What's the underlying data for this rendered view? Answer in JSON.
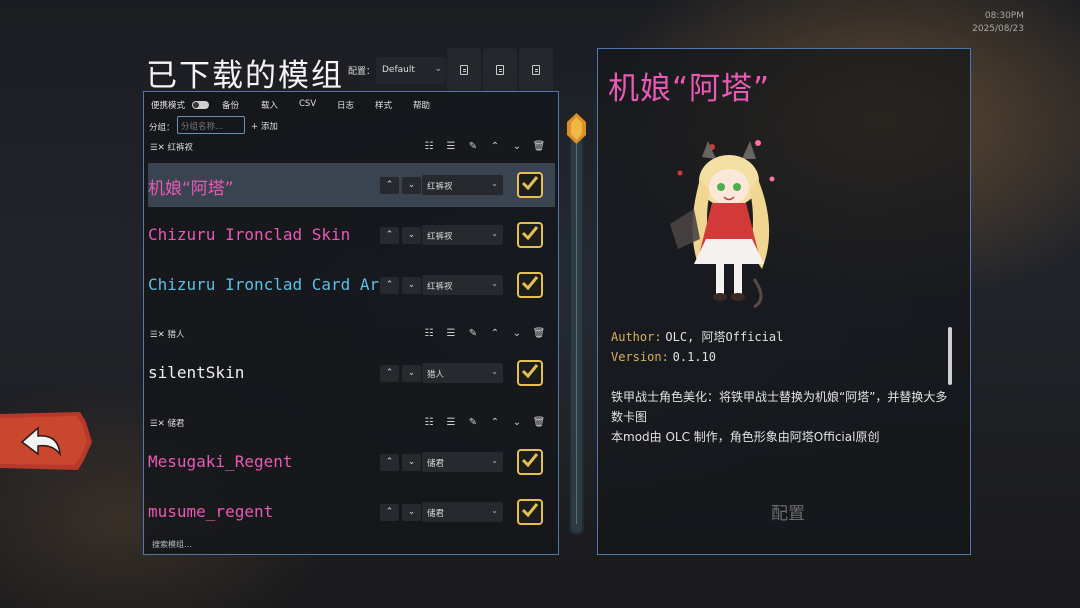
{
  "clock": {
    "time": "08:30PM",
    "date": "2025/08/23"
  },
  "header": {
    "title": "已下载的模组",
    "config_label": "配置：",
    "config_value": "Default"
  },
  "toolbar": {
    "portable_mode": "便携模式",
    "backup": "备份",
    "load": "载入",
    "csv": "CSV",
    "log": "日志",
    "style": "样式",
    "help": "帮助"
  },
  "group_bar": {
    "label": "分组：",
    "placeholder": "分组名称...",
    "add": "+ 添加"
  },
  "groups": [
    {
      "name": "红裤衩",
      "mods": [
        {
          "name": "机娘“阿塔”",
          "color": "#e85ab4",
          "group": "红裤衩",
          "enabled": true,
          "selected": true
        },
        {
          "name": "Chizuru Ironclad Skin",
          "color": "#e85ab4",
          "group": "红裤衩",
          "enabled": true,
          "selected": false
        },
        {
          "name": "Chizuru Ironclad Card Art",
          "color": "#5cc0e6",
          "group": "红裤衩",
          "enabled": true,
          "selected": false
        }
      ]
    },
    {
      "name": "猎人",
      "mods": [
        {
          "name": "silentSkin",
          "color": "#f0f0f0",
          "group": "猎人",
          "enabled": true,
          "selected": false
        }
      ]
    },
    {
      "name": "储君",
      "mods": [
        {
          "name": "Mesugaki_Regent",
          "color": "#e85ab4",
          "group": "储君",
          "enabled": true,
          "selected": false
        },
        {
          "name": "musume_regent",
          "color": "#e85ab4",
          "group": "储君",
          "enabled": true,
          "selected": false
        }
      ]
    }
  ],
  "search": {
    "placeholder": "搜索模组..."
  },
  "detail": {
    "title": "机娘“阿塔”",
    "author_label": "Author:",
    "author_value": "OLC, 阿塔Official",
    "version_label": "Version:",
    "version_value": "0.1.10",
    "description_1": "铁甲战士角色美化：将铁甲战士替换为机娘“阿塔”，并替换大多数卡图",
    "description_2": "本mod由 OLC 制作，角色形象由阿塔Official原创",
    "config_button": "配置"
  },
  "colors": {
    "accent_border": "#4d79ad",
    "pink": "#e85ab4",
    "cyan": "#5cc0e6",
    "gold": "#e5c050",
    "back_red": "#b8382a"
  },
  "icons": [
    "sort-icon",
    "collapse-icon",
    "edit-icon",
    "up-icon",
    "down-icon",
    "trash-icon",
    "checkbox-icon",
    "back-arrow-icon",
    "file-icon"
  ]
}
